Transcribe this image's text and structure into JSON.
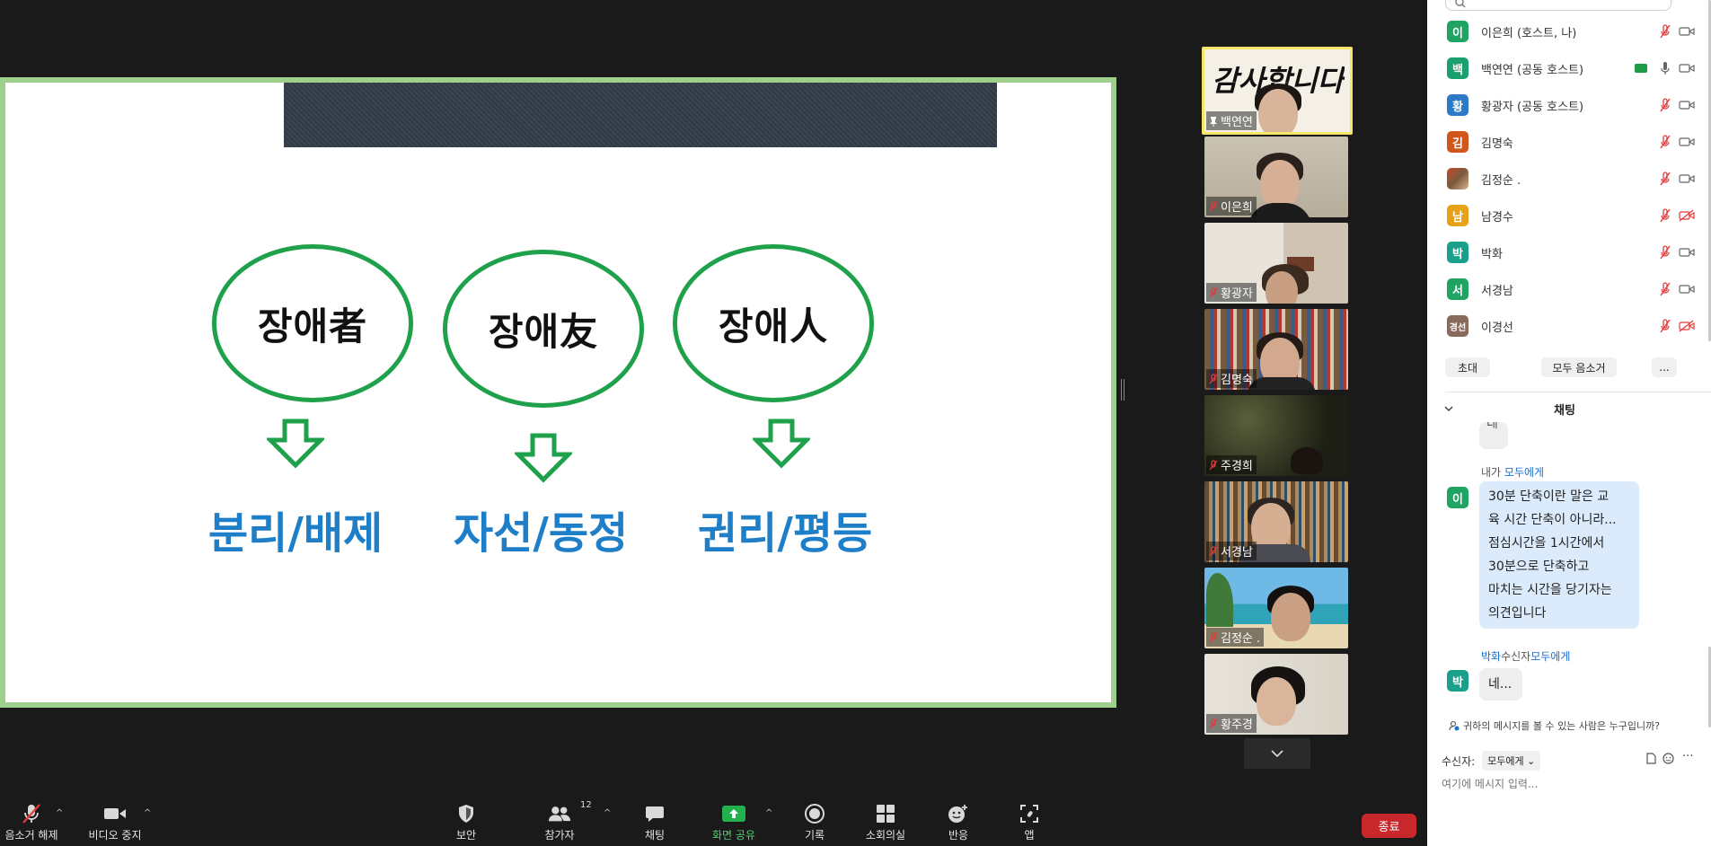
{
  "slide": {
    "concepts": [
      {
        "word": "장애者",
        "meaning": "분리/배제"
      },
      {
        "word": "장애友",
        "meaning": "자선/동정"
      },
      {
        "word": "장애人",
        "meaning": "권리/평등"
      }
    ]
  },
  "gallery": {
    "tiles": [
      {
        "name": "백연연",
        "overlay_text": "감사합니다",
        "pinned": true
      },
      {
        "name": "이은희",
        "muted": true
      },
      {
        "name": "황광자",
        "muted": true
      },
      {
        "name": "김명숙",
        "muted": true
      },
      {
        "name": "주경희",
        "muted": true
      },
      {
        "name": "서경남",
        "muted": true
      },
      {
        "name": "김정순 .",
        "muted": true
      },
      {
        "name": "황주경",
        "muted": true
      }
    ]
  },
  "toolbar": {
    "unmute": "음소거 해제",
    "stop_video": "비디오 중지",
    "security": "보안",
    "participants": "참가자",
    "participants_count": "12",
    "chat": "채팅",
    "share_screen": "화면 공유",
    "record": "기록",
    "breakout": "소회의실",
    "reactions": "반응",
    "apps": "앱",
    "end": "종료"
  },
  "participants": {
    "list": [
      {
        "avatar": "이",
        "name": "이은희 (호스트, 나)",
        "color": "#1fa463",
        "mic": "muted",
        "cam": "on"
      },
      {
        "avatar": "백",
        "name": "백연연 (공동 호스트)",
        "color": "#19a06e",
        "mic": "on",
        "cam": "on",
        "sharing": true
      },
      {
        "avatar": "황",
        "name": "황광자 (공동 호스트)",
        "color": "#2c79c7",
        "mic": "muted",
        "cam": "on"
      },
      {
        "avatar": "김",
        "name": "김명숙",
        "color": "#d0561b",
        "mic": "muted",
        "cam": "on"
      },
      {
        "avatar": "",
        "name": "김정순 .",
        "color": "#8a6f5a",
        "mic": "muted",
        "cam": "on"
      },
      {
        "avatar": "남",
        "name": "남경수",
        "color": "#e8a21a",
        "mic": "muted",
        "cam": "off"
      },
      {
        "avatar": "박",
        "name": "박화",
        "color": "#18a08a",
        "mic": "muted",
        "cam": "on"
      },
      {
        "avatar": "서",
        "name": "서경남",
        "color": "#1fa463",
        "mic": "muted",
        "cam": "on"
      },
      {
        "avatar": "경선",
        "name": "이경선",
        "color": "#8b6a5e",
        "mic": "muted",
        "cam": "off"
      }
    ],
    "invite": "초대",
    "mute_all": "모두 음소거",
    "more": "..."
  },
  "chat": {
    "title": "채팅",
    "prev_bubble": "네",
    "messages": [
      {
        "avatar": "이",
        "avatar_color": "#1fa463",
        "sender": "내가",
        "to": "모두에게",
        "lines": [
          "30분 단축이란 말은 교",
          "육 시간 단축이 아니라...",
          "점심시간을 1시간에서",
          "30분으로 단축하고",
          "마치는 시간을 당기자는",
          "의견입니다"
        ]
      },
      {
        "avatar": "박",
        "avatar_color": "#18a08a",
        "sender": "박화",
        "via": "수신자",
        "to": "모두에게",
        "lines": [
          "네..."
        ]
      }
    ],
    "privacy_note": "귀하의 메시지를 볼 수 있는 사람은 누구입니까?",
    "recipient_label": "수신자:",
    "recipient_value": "모두에게",
    "input_placeholder": "여기에 메시지 입력..."
  }
}
